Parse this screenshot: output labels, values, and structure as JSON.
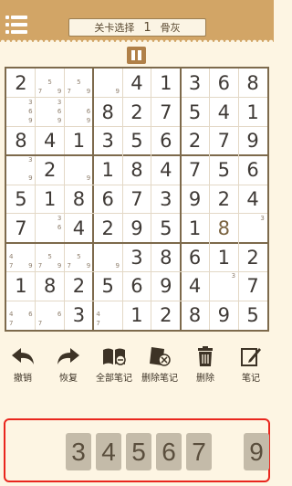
{
  "header": {
    "level_label": "关卡选择",
    "level_number": "1",
    "difficulty": "骨灰"
  },
  "board": {
    "cells": [
      [
        {
          "v": "2",
          "g": true
        },
        {
          "n": [
            "5",
            "7",
            "9"
          ]
        },
        {
          "n": [
            "5",
            "7",
            "9"
          ]
        },
        {
          "n": [
            "9"
          ]
        },
        {
          "v": "4",
          "g": true
        },
        {
          "v": "1",
          "g": true
        },
        {
          "v": "3",
          "g": true
        },
        {
          "v": "6",
          "g": true
        },
        {
          "v": "8",
          "g": true
        }
      ],
      [
        {
          "n": [
            "3",
            "6",
            "9"
          ]
        },
        {
          "n": [
            "3",
            "6",
            "9"
          ]
        },
        {
          "n": [
            "6",
            "9"
          ]
        },
        {
          "v": "8",
          "g": true
        },
        {
          "v": "2",
          "g": true
        },
        {
          "v": "7",
          "g": true
        },
        {
          "v": "5",
          "g": true
        },
        {
          "v": "4",
          "g": true
        },
        {
          "v": "1",
          "g": true
        }
      ],
      [
        {
          "v": "8",
          "g": true
        },
        {
          "v": "4",
          "g": true
        },
        {
          "v": "1",
          "g": true
        },
        {
          "v": "3",
          "g": true
        },
        {
          "v": "5",
          "g": true
        },
        {
          "v": "6",
          "g": true
        },
        {
          "v": "2",
          "g": true
        },
        {
          "v": "7",
          "g": true
        },
        {
          "v": "9",
          "g": true
        }
      ],
      [
        {
          "n": [
            "3",
            "9"
          ]
        },
        {
          "v": "2",
          "g": true
        },
        {
          "n": [
            "9"
          ]
        },
        {
          "v": "1",
          "g": true
        },
        {
          "v": "8",
          "g": true
        },
        {
          "v": "4",
          "g": true
        },
        {
          "v": "7",
          "g": true
        },
        {
          "v": "5",
          "g": true
        },
        {
          "v": "6",
          "g": true
        }
      ],
      [
        {
          "v": "5",
          "g": true
        },
        {
          "v": "1",
          "g": true
        },
        {
          "v": "8",
          "g": true
        },
        {
          "v": "6",
          "g": true
        },
        {
          "v": "7",
          "g": true
        },
        {
          "v": "3",
          "g": true
        },
        {
          "v": "9",
          "g": true
        },
        {
          "v": "2",
          "g": true
        },
        {
          "v": "4",
          "g": true
        }
      ],
      [
        {
          "v": "7",
          "g": true
        },
        {
          "n": [
            "3",
            "6"
          ]
        },
        {
          "v": "4",
          "g": true
        },
        {
          "v": "2",
          "g": true
        },
        {
          "v": "9",
          "g": true
        },
        {
          "v": "5",
          "g": true
        },
        {
          "v": "1",
          "g": true
        },
        {
          "v": "8",
          "g": false
        },
        {
          "n": [
            "3"
          ]
        }
      ],
      [
        {
          "n": [
            "4",
            "9",
            "7"
          ]
        },
        {
          "n": [
            "5",
            "7",
            "9"
          ]
        },
        {
          "n": [
            "5",
            "7",
            "9"
          ]
        },
        {
          "n": [
            "9"
          ]
        },
        {
          "v": "3",
          "g": true
        },
        {
          "v": "8",
          "g": true
        },
        {
          "v": "6",
          "g": true
        },
        {
          "v": "1",
          "g": true
        },
        {
          "v": "2",
          "g": true
        }
      ],
      [
        {
          "v": "1",
          "g": true
        },
        {
          "v": "8",
          "g": true
        },
        {
          "v": "2",
          "g": true
        },
        {
          "v": "5",
          "g": true
        },
        {
          "v": "6",
          "g": true
        },
        {
          "v": "9",
          "g": true
        },
        {
          "v": "4",
          "g": true
        },
        {
          "n": [
            "3"
          ]
        },
        {
          "v": "7",
          "g": true
        }
      ],
      [
        {
          "n": [
            "4",
            "6",
            "7"
          ]
        },
        {
          "n": [
            "6",
            "7"
          ]
        },
        {
          "v": "3",
          "g": true
        },
        {
          "n": [
            "4",
            "7"
          ]
        },
        {
          "v": "1",
          "g": true
        },
        {
          "v": "2",
          "g": true
        },
        {
          "v": "8",
          "g": true
        },
        {
          "v": "9",
          "g": true
        },
        {
          "v": "5",
          "g": true
        }
      ]
    ]
  },
  "toolbar": [
    {
      "label": "撤销",
      "icon": "undo-icon"
    },
    {
      "label": "恢复",
      "icon": "redo-icon"
    },
    {
      "label": "全部笔记",
      "icon": "all-notes-icon"
    },
    {
      "label": "删除笔记",
      "icon": "delete-notes-icon"
    },
    {
      "label": "删除",
      "icon": "trash-icon"
    },
    {
      "label": "笔记",
      "icon": "pencil-note-icon"
    }
  ],
  "numpad": {
    "keys": [
      "3",
      "4",
      "5",
      "6",
      "7",
      "9"
    ]
  },
  "colors": {
    "accent": "#d2a566",
    "highlight": "#e9261d"
  }
}
